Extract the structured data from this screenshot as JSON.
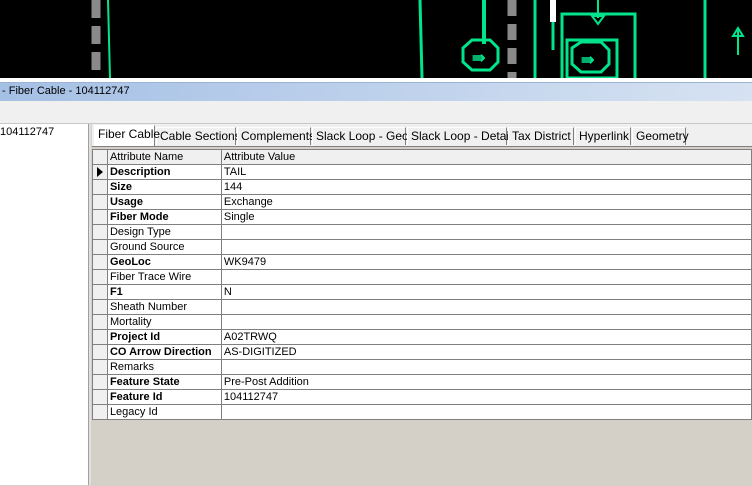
{
  "window": {
    "title": "- Fiber Cable - 104112747"
  },
  "tree": {
    "selected_item": "104112747"
  },
  "tabs": [
    {
      "label": "Fiber Cable",
      "active": true
    },
    {
      "label": "Cable Sections",
      "active": false
    },
    {
      "label": "Complements",
      "active": false
    },
    {
      "label": "Slack Loop - Geo",
      "active": false
    },
    {
      "label": "Slack Loop - Detail",
      "active": false
    },
    {
      "label": "Tax District",
      "active": false
    },
    {
      "label": "Hyperlink",
      "active": false
    },
    {
      "label": "Geometry",
      "active": false
    }
  ],
  "grid": {
    "headers": {
      "name": "Attribute Name",
      "value": "Attribute Value"
    },
    "rows": [
      {
        "name": "Description",
        "value": "TAIL",
        "bold": true,
        "current": true
      },
      {
        "name": "Size",
        "value": "144",
        "bold": true
      },
      {
        "name": "Usage",
        "value": "Exchange",
        "bold": true
      },
      {
        "name": "Fiber Mode",
        "value": "Single",
        "bold": true
      },
      {
        "name": "Design Type",
        "value": "",
        "bold": false
      },
      {
        "name": "Ground Source",
        "value": "",
        "bold": false
      },
      {
        "name": "GeoLoc",
        "value": "WK9479",
        "bold": true
      },
      {
        "name": "Fiber Trace Wire",
        "value": "",
        "bold": false
      },
      {
        "name": "F1",
        "value": "N",
        "bold": true
      },
      {
        "name": "Sheath Number",
        "value": "",
        "bold": false
      },
      {
        "name": "Mortality",
        "value": "",
        "bold": false
      },
      {
        "name": "Project Id",
        "value": "A02TRWQ",
        "bold": true
      },
      {
        "name": "CO Arrow Direction",
        "value": "AS-DIGITIZED",
        "bold": true
      },
      {
        "name": "Remarks",
        "value": "",
        "bold": false
      },
      {
        "name": "Feature State",
        "value": "Pre-Post Addition",
        "bold": true
      },
      {
        "name": "Feature Id",
        "value": "104112747",
        "bold": true
      },
      {
        "name": "Legacy Id",
        "value": "",
        "bold": false
      }
    ]
  },
  "colors": {
    "map_bg": "#000000",
    "map_line": "#00e58c",
    "map_gray": "#8a8a8a"
  }
}
